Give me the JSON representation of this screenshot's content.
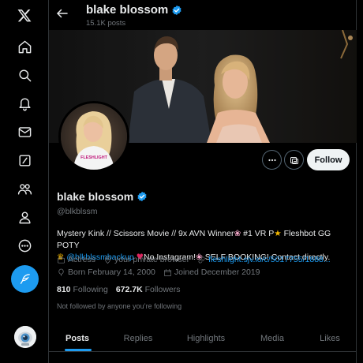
{
  "nav": {
    "items": [
      {
        "icon": "x-logo-icon",
        "label": "X"
      },
      {
        "icon": "home-icon",
        "label": "Home"
      },
      {
        "icon": "search-icon",
        "label": "Explore"
      },
      {
        "icon": "bell-icon",
        "label": "Notifications"
      },
      {
        "icon": "mail-icon",
        "label": "Messages"
      },
      {
        "icon": "grok-icon",
        "label": "Grok"
      },
      {
        "icon": "communities-icon",
        "label": "Communities"
      },
      {
        "icon": "profile-icon",
        "label": "Profile"
      },
      {
        "icon": "more-icon",
        "label": "More"
      }
    ],
    "post_button_icon": "feather-icon"
  },
  "header": {
    "title": "blake blossom",
    "post_count": "15.1K posts"
  },
  "profile": {
    "name": "blake blossom",
    "handle": "@blkblssm",
    "bio_line1": "Mystery Kink // Scissors Movie // 9x AVN Winner",
    "bio_line1b": " #1 VR P",
    "bio_line1c": " Fleshbot GG POTY",
    "bio_link": "@blkblssmbackup",
    "bio_line2a": "No Instagram!",
    "bio_line2b": " SELF BOOKING! Contact directly.",
    "shirt_text": "FLESHLIGHT",
    "category": "Actress",
    "location": "your private browser",
    "website": "fleshlight.sjv.io/c/5017755/1888...",
    "born": "Born February 14, 2000",
    "joined": "Joined December 2019",
    "following_count": "810",
    "following_label": "Following",
    "followers_count": "672.7K",
    "followers_label": "Followers",
    "follow_note": "Not followed by anyone you’re following"
  },
  "actions": {
    "follow_label": "Follow"
  },
  "tabs": [
    "Posts",
    "Replies",
    "Highlights",
    "Media",
    "Likes"
  ],
  "colors": {
    "accent": "#1d9bf0",
    "background": "#000000",
    "text": "#e7e9ea",
    "muted": "#71767b"
  }
}
